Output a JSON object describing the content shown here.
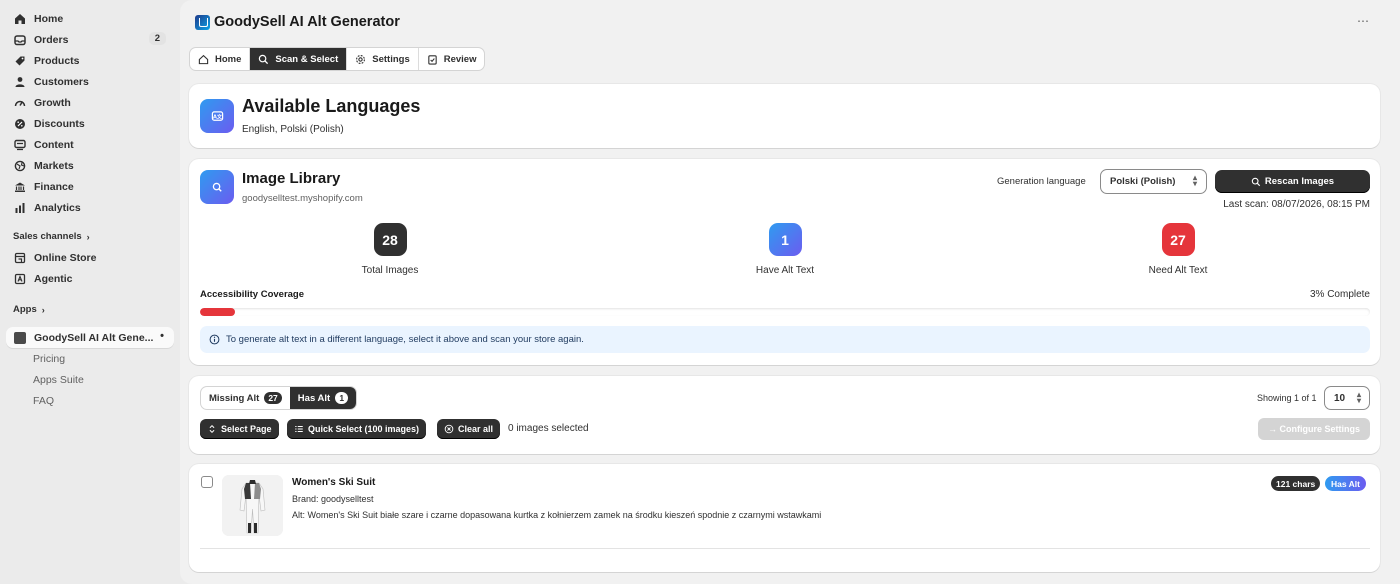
{
  "sidebar": {
    "items": [
      {
        "label": "Home",
        "icon": "home-icon"
      },
      {
        "label": "Orders",
        "icon": "inbox-icon",
        "badge": "2"
      },
      {
        "label": "Products",
        "icon": "tag-icon"
      },
      {
        "label": "Customers",
        "icon": "person-icon"
      },
      {
        "label": "Growth",
        "icon": "gauge-icon"
      },
      {
        "label": "Discounts",
        "icon": "discount-icon"
      },
      {
        "label": "Content",
        "icon": "content-icon"
      },
      {
        "label": "Markets",
        "icon": "globe-icon"
      },
      {
        "label": "Finance",
        "icon": "bank-icon"
      },
      {
        "label": "Analytics",
        "icon": "bar-chart-icon"
      }
    ],
    "sales_channels_label": "Sales channels",
    "channels": [
      {
        "label": "Online Store",
        "icon": "store-icon"
      },
      {
        "label": "Agentic",
        "icon": "agentic-icon"
      }
    ],
    "apps_label": "Apps",
    "app_item": "GoodySell AI Alt Gene...",
    "app_sub_items": [
      "Pricing",
      "Apps Suite",
      "FAQ"
    ]
  },
  "header": {
    "title": "GoodySell AI Alt Generator",
    "more": "⋯"
  },
  "tabs": [
    {
      "label": "Home",
      "active": false
    },
    {
      "label": "Scan & Select",
      "active": true
    },
    {
      "label": "Settings",
      "active": false
    },
    {
      "label": "Review",
      "active": false
    }
  ],
  "languages": {
    "title": "Available Languages",
    "list": "English, Polski (Polish)"
  },
  "library": {
    "title": "Image Library",
    "domain": "goodyselltest.myshopify.com",
    "generation_label": "Generation language",
    "generation_value": "Polski (Polish)",
    "rescan_label": "Rescan Images",
    "last_scan": "Last scan: 08/07/2026, 08:15 PM",
    "stats": [
      {
        "value": "28",
        "label": "Total Images",
        "color": "#303030"
      },
      {
        "value": "1",
        "label": "Have Alt Text",
        "color": "#4f8ff7"
      },
      {
        "value": "27",
        "label": "Need Alt Text",
        "color": "#e5353b"
      }
    ],
    "coverage_label": "Accessibility Coverage",
    "coverage_text": "3% Complete",
    "coverage_fraction": 0.03,
    "info": "To generate alt text in a different language, select it above and scan your store again."
  },
  "filters": {
    "missing_label": "Missing Alt",
    "missing_count": "27",
    "has_label": "Has Alt",
    "has_count": "1",
    "active": "has",
    "showing": "Showing 1 of 1",
    "per_page": "10",
    "select_page": "Select Page",
    "quick_select": "Quick Select (100 images)",
    "clear_all": "Clear all",
    "selected_text": "0 images selected",
    "configure": "→ Configure Settings"
  },
  "products": [
    {
      "title": "Women's Ski Suit",
      "brand": "Brand: goodyselltest",
      "alt": "Alt: Women's Ski Suit białe szare i czarne dopasowana kurtka z kołnierzem zamek na środku kieszeń spodnie z czarnymi wstawkami",
      "chars": "121 chars",
      "status": "Has Alt"
    }
  ],
  "colors": {
    "accent_dark": "#303030",
    "progress_red": "#e5353b",
    "info_bg": "#eaf4ff",
    "gradient_start": "#2f9bf0",
    "gradient_end": "#6b5cf0"
  }
}
